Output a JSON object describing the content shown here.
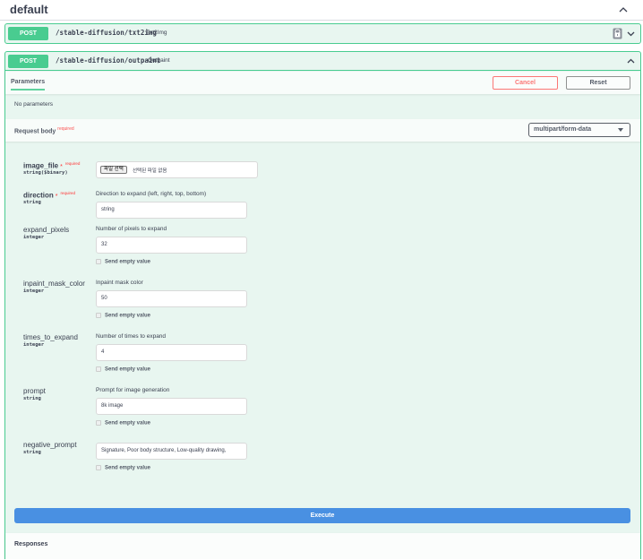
{
  "tag": {
    "title": "default"
  },
  "operations": [
    {
      "method": "POST",
      "path": "/stable-diffusion/txt2img",
      "description": "Txt2Img"
    },
    {
      "method": "POST",
      "path": "/stable-diffusion/outpaint",
      "description": "Outpaint"
    }
  ],
  "parameters": {
    "tab_label": "Parameters",
    "cancel_label": "Cancel",
    "reset_label": "Reset",
    "empty_text": "No parameters"
  },
  "request_body": {
    "title": "Request body",
    "required_label": "required",
    "content_type": "multipart/form-data",
    "fields": [
      {
        "name": "image_file",
        "required_label": "required",
        "type": "string($binary)",
        "file_button": "파일 선택",
        "file_status": "선택된 파일 없음"
      },
      {
        "name": "direction",
        "required_label": "required",
        "type": "string",
        "description": "Direction to expand (left, right, top, bottom)",
        "value": "string"
      },
      {
        "name": "expand_pixels",
        "type": "integer",
        "description": "Number of pixels to expand",
        "value": "32",
        "empty_label": "Send empty value"
      },
      {
        "name": "inpaint_mask_color",
        "type": "integer",
        "description": "Inpaint mask color",
        "value": "50",
        "empty_label": "Send empty value"
      },
      {
        "name": "times_to_expand",
        "type": "integer",
        "description": "Number of times to expand",
        "value": "4",
        "empty_label": "Send empty value"
      },
      {
        "name": "prompt",
        "type": "string",
        "description": "Prompt for image generation",
        "value": "8k image",
        "empty_label": "Send empty value"
      },
      {
        "name": "negative_prompt",
        "type": "string",
        "value": "Signature, Poor body structure, Low-quality drawing,",
        "empty_label": "Send empty value"
      }
    ]
  },
  "execute_label": "Execute",
  "responses": {
    "title": "Responses"
  },
  "colors": {
    "post": "#49cc90",
    "execute": "#4990e2",
    "cancel": "#ff6060",
    "required": "#ff3333"
  }
}
